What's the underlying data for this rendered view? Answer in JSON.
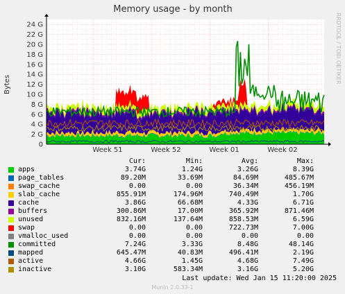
{
  "chart_data": {
    "type": "area",
    "title": "Memory usage - by month",
    "ylabel": "Bytes",
    "side_label": "RRDTOOL / TOBI OETIKER",
    "ylim": [
      0,
      25
    ],
    "y_unit": "G",
    "y_ticks": [
      "0",
      "2 G",
      "4 G",
      "6 G",
      "8 G",
      "10 G",
      "12 G",
      "14 G",
      "16 G",
      "18 G",
      "20 G",
      "22 G",
      "24 G"
    ],
    "x_ticks": [
      "Week 51",
      "Week 52",
      "Week 01",
      "Week 02"
    ],
    "grid": true,
    "legend_headers": [
      "Cur:",
      "Min:",
      "Avg:",
      "Max:"
    ],
    "series": [
      {
        "name": "apps",
        "color": "#00cc00",
        "cur": "3.74G",
        "min": "1.24G",
        "avg": "3.26G",
        "max": "8.39G"
      },
      {
        "name": "page_tables",
        "color": "#0066b3",
        "cur": "89.20M",
        "min": "33.69M",
        "avg": "84.69M",
        "max": "485.67M"
      },
      {
        "name": "swap_cache",
        "color": "#ff8000",
        "cur": "0.00",
        "min": "0.00",
        "avg": "36.34M",
        "max": "456.19M"
      },
      {
        "name": "slab_cache",
        "color": "#ffcc00",
        "cur": "855.91M",
        "min": "174.96M",
        "avg": "740.49M",
        "max": "1.70G"
      },
      {
        "name": "cache",
        "color": "#330099",
        "cur": "3.86G",
        "min": "66.68M",
        "avg": "4.33G",
        "max": "6.71G"
      },
      {
        "name": "buffers",
        "color": "#990099",
        "cur": "300.86M",
        "min": "17.00M",
        "avg": "365.92M",
        "max": "871.46M"
      },
      {
        "name": "unused",
        "color": "#ccff00",
        "cur": "832.16M",
        "min": "137.64M",
        "avg": "858.53M",
        "max": "6.59G"
      },
      {
        "name": "swap",
        "color": "#ff0000",
        "cur": "0.00",
        "min": "0.00",
        "avg": "722.73M",
        "max": "7.00G"
      },
      {
        "name": "vmalloc_used",
        "color": "#808080",
        "cur": "0.00",
        "min": "0.00",
        "avg": "0.00",
        "max": "0.00"
      },
      {
        "name": "committed",
        "color": "#008f00",
        "cur": "7.24G",
        "min": "3.33G",
        "avg": "8.48G",
        "max": "48.14G"
      },
      {
        "name": "mapped",
        "color": "#00487d",
        "cur": "645.47M",
        "min": "40.83M",
        "avg": "496.41M",
        "max": "2.19G"
      },
      {
        "name": "active",
        "color": "#b35a00",
        "cur": "4.66G",
        "min": "1.45G",
        "avg": "4.68G",
        "max": "7.49G"
      },
      {
        "name": "inactive",
        "color": "#b38f00",
        "cur": "3.10G",
        "min": "583.34M",
        "avg": "3.16G",
        "max": "5.20G"
      }
    ]
  },
  "last_update_label": "Last update:",
  "last_update_value": "Wed Jan 15 11:20:00 2025",
  "footer": "Munin 2.0.33-1"
}
